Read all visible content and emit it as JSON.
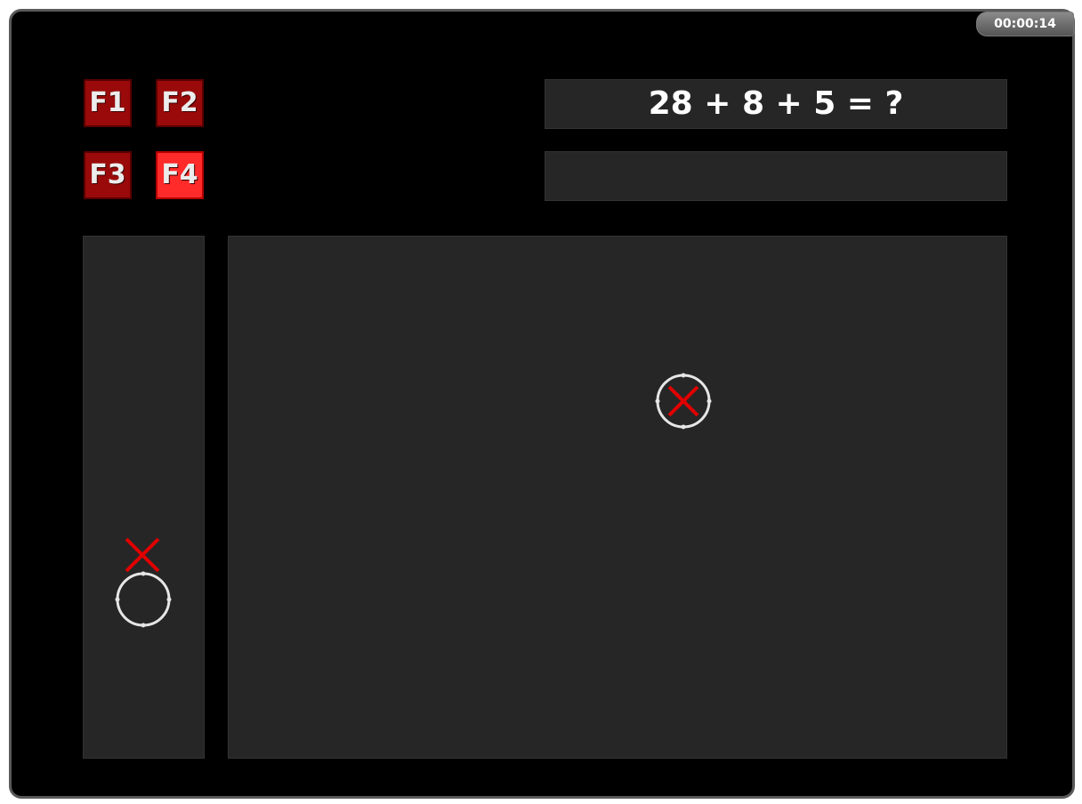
{
  "timer": "00:00:14",
  "function_keys": [
    {
      "label": "F1",
      "active": false
    },
    {
      "label": "F2",
      "active": false
    },
    {
      "label": "F3",
      "active": false
    },
    {
      "label": "F4",
      "active": true
    }
  ],
  "question": "28 + 8 + 5 = ?",
  "answer": "",
  "colors": {
    "background": "#000000",
    "panel": "#262626",
    "key": "#9a0a0a",
    "key_active": "#ff2a2a",
    "marker_red": "#e00000",
    "ring": "#e6e6e6"
  },
  "icons": {
    "target": "crosshair-circle-with-x",
    "side_x": "red-x-mark",
    "side_ring": "crosshair-circle"
  }
}
